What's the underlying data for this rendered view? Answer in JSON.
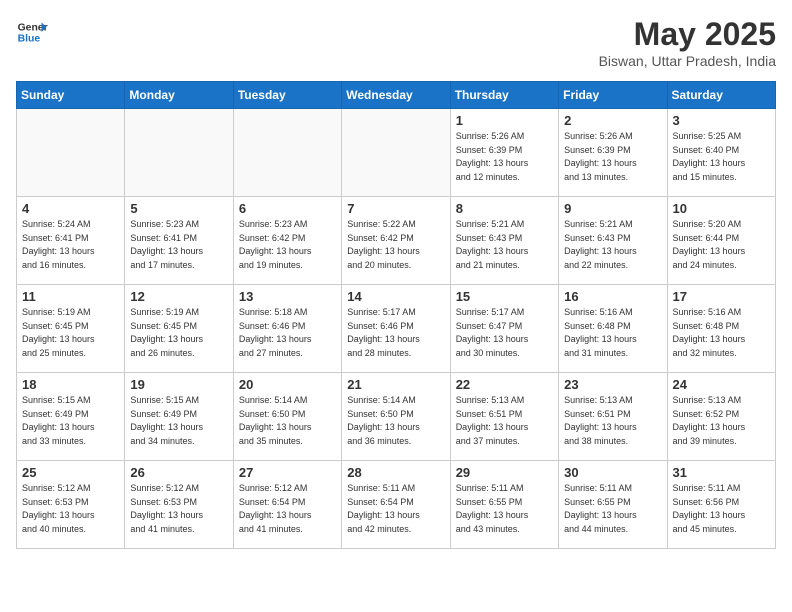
{
  "header": {
    "logo_line1": "General",
    "logo_line2": "Blue",
    "title": "May 2025",
    "subtitle": "Biswan, Uttar Pradesh, India"
  },
  "weekdays": [
    "Sunday",
    "Monday",
    "Tuesday",
    "Wednesday",
    "Thursday",
    "Friday",
    "Saturday"
  ],
  "weeks": [
    [
      {
        "day": "",
        "info": ""
      },
      {
        "day": "",
        "info": ""
      },
      {
        "day": "",
        "info": ""
      },
      {
        "day": "",
        "info": ""
      },
      {
        "day": "1",
        "info": "Sunrise: 5:26 AM\nSunset: 6:39 PM\nDaylight: 13 hours\nand 12 minutes."
      },
      {
        "day": "2",
        "info": "Sunrise: 5:26 AM\nSunset: 6:39 PM\nDaylight: 13 hours\nand 13 minutes."
      },
      {
        "day": "3",
        "info": "Sunrise: 5:25 AM\nSunset: 6:40 PM\nDaylight: 13 hours\nand 15 minutes."
      }
    ],
    [
      {
        "day": "4",
        "info": "Sunrise: 5:24 AM\nSunset: 6:41 PM\nDaylight: 13 hours\nand 16 minutes."
      },
      {
        "day": "5",
        "info": "Sunrise: 5:23 AM\nSunset: 6:41 PM\nDaylight: 13 hours\nand 17 minutes."
      },
      {
        "day": "6",
        "info": "Sunrise: 5:23 AM\nSunset: 6:42 PM\nDaylight: 13 hours\nand 19 minutes."
      },
      {
        "day": "7",
        "info": "Sunrise: 5:22 AM\nSunset: 6:42 PM\nDaylight: 13 hours\nand 20 minutes."
      },
      {
        "day": "8",
        "info": "Sunrise: 5:21 AM\nSunset: 6:43 PM\nDaylight: 13 hours\nand 21 minutes."
      },
      {
        "day": "9",
        "info": "Sunrise: 5:21 AM\nSunset: 6:43 PM\nDaylight: 13 hours\nand 22 minutes."
      },
      {
        "day": "10",
        "info": "Sunrise: 5:20 AM\nSunset: 6:44 PM\nDaylight: 13 hours\nand 24 minutes."
      }
    ],
    [
      {
        "day": "11",
        "info": "Sunrise: 5:19 AM\nSunset: 6:45 PM\nDaylight: 13 hours\nand 25 minutes."
      },
      {
        "day": "12",
        "info": "Sunrise: 5:19 AM\nSunset: 6:45 PM\nDaylight: 13 hours\nand 26 minutes."
      },
      {
        "day": "13",
        "info": "Sunrise: 5:18 AM\nSunset: 6:46 PM\nDaylight: 13 hours\nand 27 minutes."
      },
      {
        "day": "14",
        "info": "Sunrise: 5:17 AM\nSunset: 6:46 PM\nDaylight: 13 hours\nand 28 minutes."
      },
      {
        "day": "15",
        "info": "Sunrise: 5:17 AM\nSunset: 6:47 PM\nDaylight: 13 hours\nand 30 minutes."
      },
      {
        "day": "16",
        "info": "Sunrise: 5:16 AM\nSunset: 6:48 PM\nDaylight: 13 hours\nand 31 minutes."
      },
      {
        "day": "17",
        "info": "Sunrise: 5:16 AM\nSunset: 6:48 PM\nDaylight: 13 hours\nand 32 minutes."
      }
    ],
    [
      {
        "day": "18",
        "info": "Sunrise: 5:15 AM\nSunset: 6:49 PM\nDaylight: 13 hours\nand 33 minutes."
      },
      {
        "day": "19",
        "info": "Sunrise: 5:15 AM\nSunset: 6:49 PM\nDaylight: 13 hours\nand 34 minutes."
      },
      {
        "day": "20",
        "info": "Sunrise: 5:14 AM\nSunset: 6:50 PM\nDaylight: 13 hours\nand 35 minutes."
      },
      {
        "day": "21",
        "info": "Sunrise: 5:14 AM\nSunset: 6:50 PM\nDaylight: 13 hours\nand 36 minutes."
      },
      {
        "day": "22",
        "info": "Sunrise: 5:13 AM\nSunset: 6:51 PM\nDaylight: 13 hours\nand 37 minutes."
      },
      {
        "day": "23",
        "info": "Sunrise: 5:13 AM\nSunset: 6:51 PM\nDaylight: 13 hours\nand 38 minutes."
      },
      {
        "day": "24",
        "info": "Sunrise: 5:13 AM\nSunset: 6:52 PM\nDaylight: 13 hours\nand 39 minutes."
      }
    ],
    [
      {
        "day": "25",
        "info": "Sunrise: 5:12 AM\nSunset: 6:53 PM\nDaylight: 13 hours\nand 40 minutes."
      },
      {
        "day": "26",
        "info": "Sunrise: 5:12 AM\nSunset: 6:53 PM\nDaylight: 13 hours\nand 41 minutes."
      },
      {
        "day": "27",
        "info": "Sunrise: 5:12 AM\nSunset: 6:54 PM\nDaylight: 13 hours\nand 41 minutes."
      },
      {
        "day": "28",
        "info": "Sunrise: 5:11 AM\nSunset: 6:54 PM\nDaylight: 13 hours\nand 42 minutes."
      },
      {
        "day": "29",
        "info": "Sunrise: 5:11 AM\nSunset: 6:55 PM\nDaylight: 13 hours\nand 43 minutes."
      },
      {
        "day": "30",
        "info": "Sunrise: 5:11 AM\nSunset: 6:55 PM\nDaylight: 13 hours\nand 44 minutes."
      },
      {
        "day": "31",
        "info": "Sunrise: 5:11 AM\nSunset: 6:56 PM\nDaylight: 13 hours\nand 45 minutes."
      }
    ]
  ]
}
